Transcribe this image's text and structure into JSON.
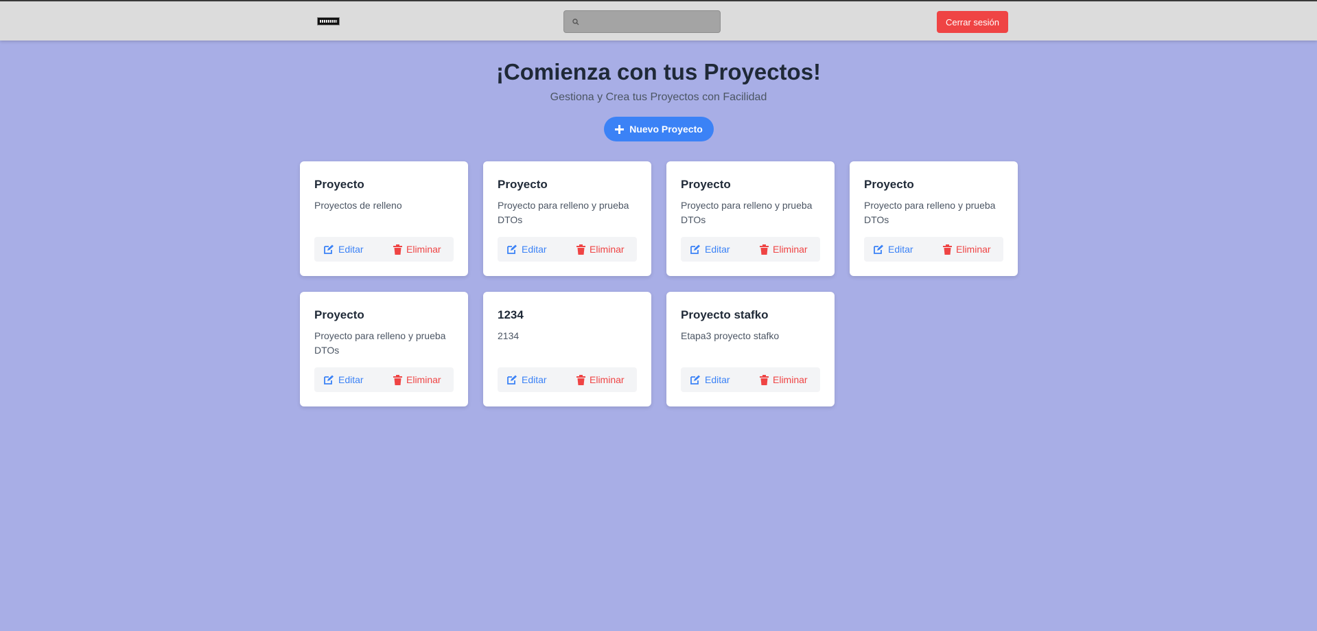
{
  "header": {
    "search_placeholder": "",
    "logout_label": "Cerrar sesión"
  },
  "main": {
    "title": "¡Comienza con tus Proyectos!",
    "subtitle": "Gestiona y Crea tus Proyectos con Facilidad",
    "new_project_label": "Nuevo Proyecto"
  },
  "actions": {
    "edit_label": "Editar",
    "delete_label": "Eliminar"
  },
  "projects": [
    {
      "title": "Proyecto",
      "description": "Proyectos de relleno"
    },
    {
      "title": "Proyecto",
      "description": "Proyecto para relleno y prueba DTOs"
    },
    {
      "title": "Proyecto",
      "description": "Proyecto para relleno y prueba DTOs"
    },
    {
      "title": "Proyecto",
      "description": "Proyecto para relleno y prueba DTOs"
    },
    {
      "title": "Proyecto",
      "description": "Proyecto para relleno y prueba DTOs"
    },
    {
      "title": "1234",
      "description": "2134"
    },
    {
      "title": "Proyecto stafko",
      "description": "Etapa3 proyecto stafko"
    }
  ],
  "colors": {
    "background": "#a8aee6",
    "primary": "#3b82f6",
    "danger": "#ef4444"
  },
  "icons": [
    "search-icon",
    "plus-icon",
    "edit-icon",
    "trash-icon"
  ]
}
